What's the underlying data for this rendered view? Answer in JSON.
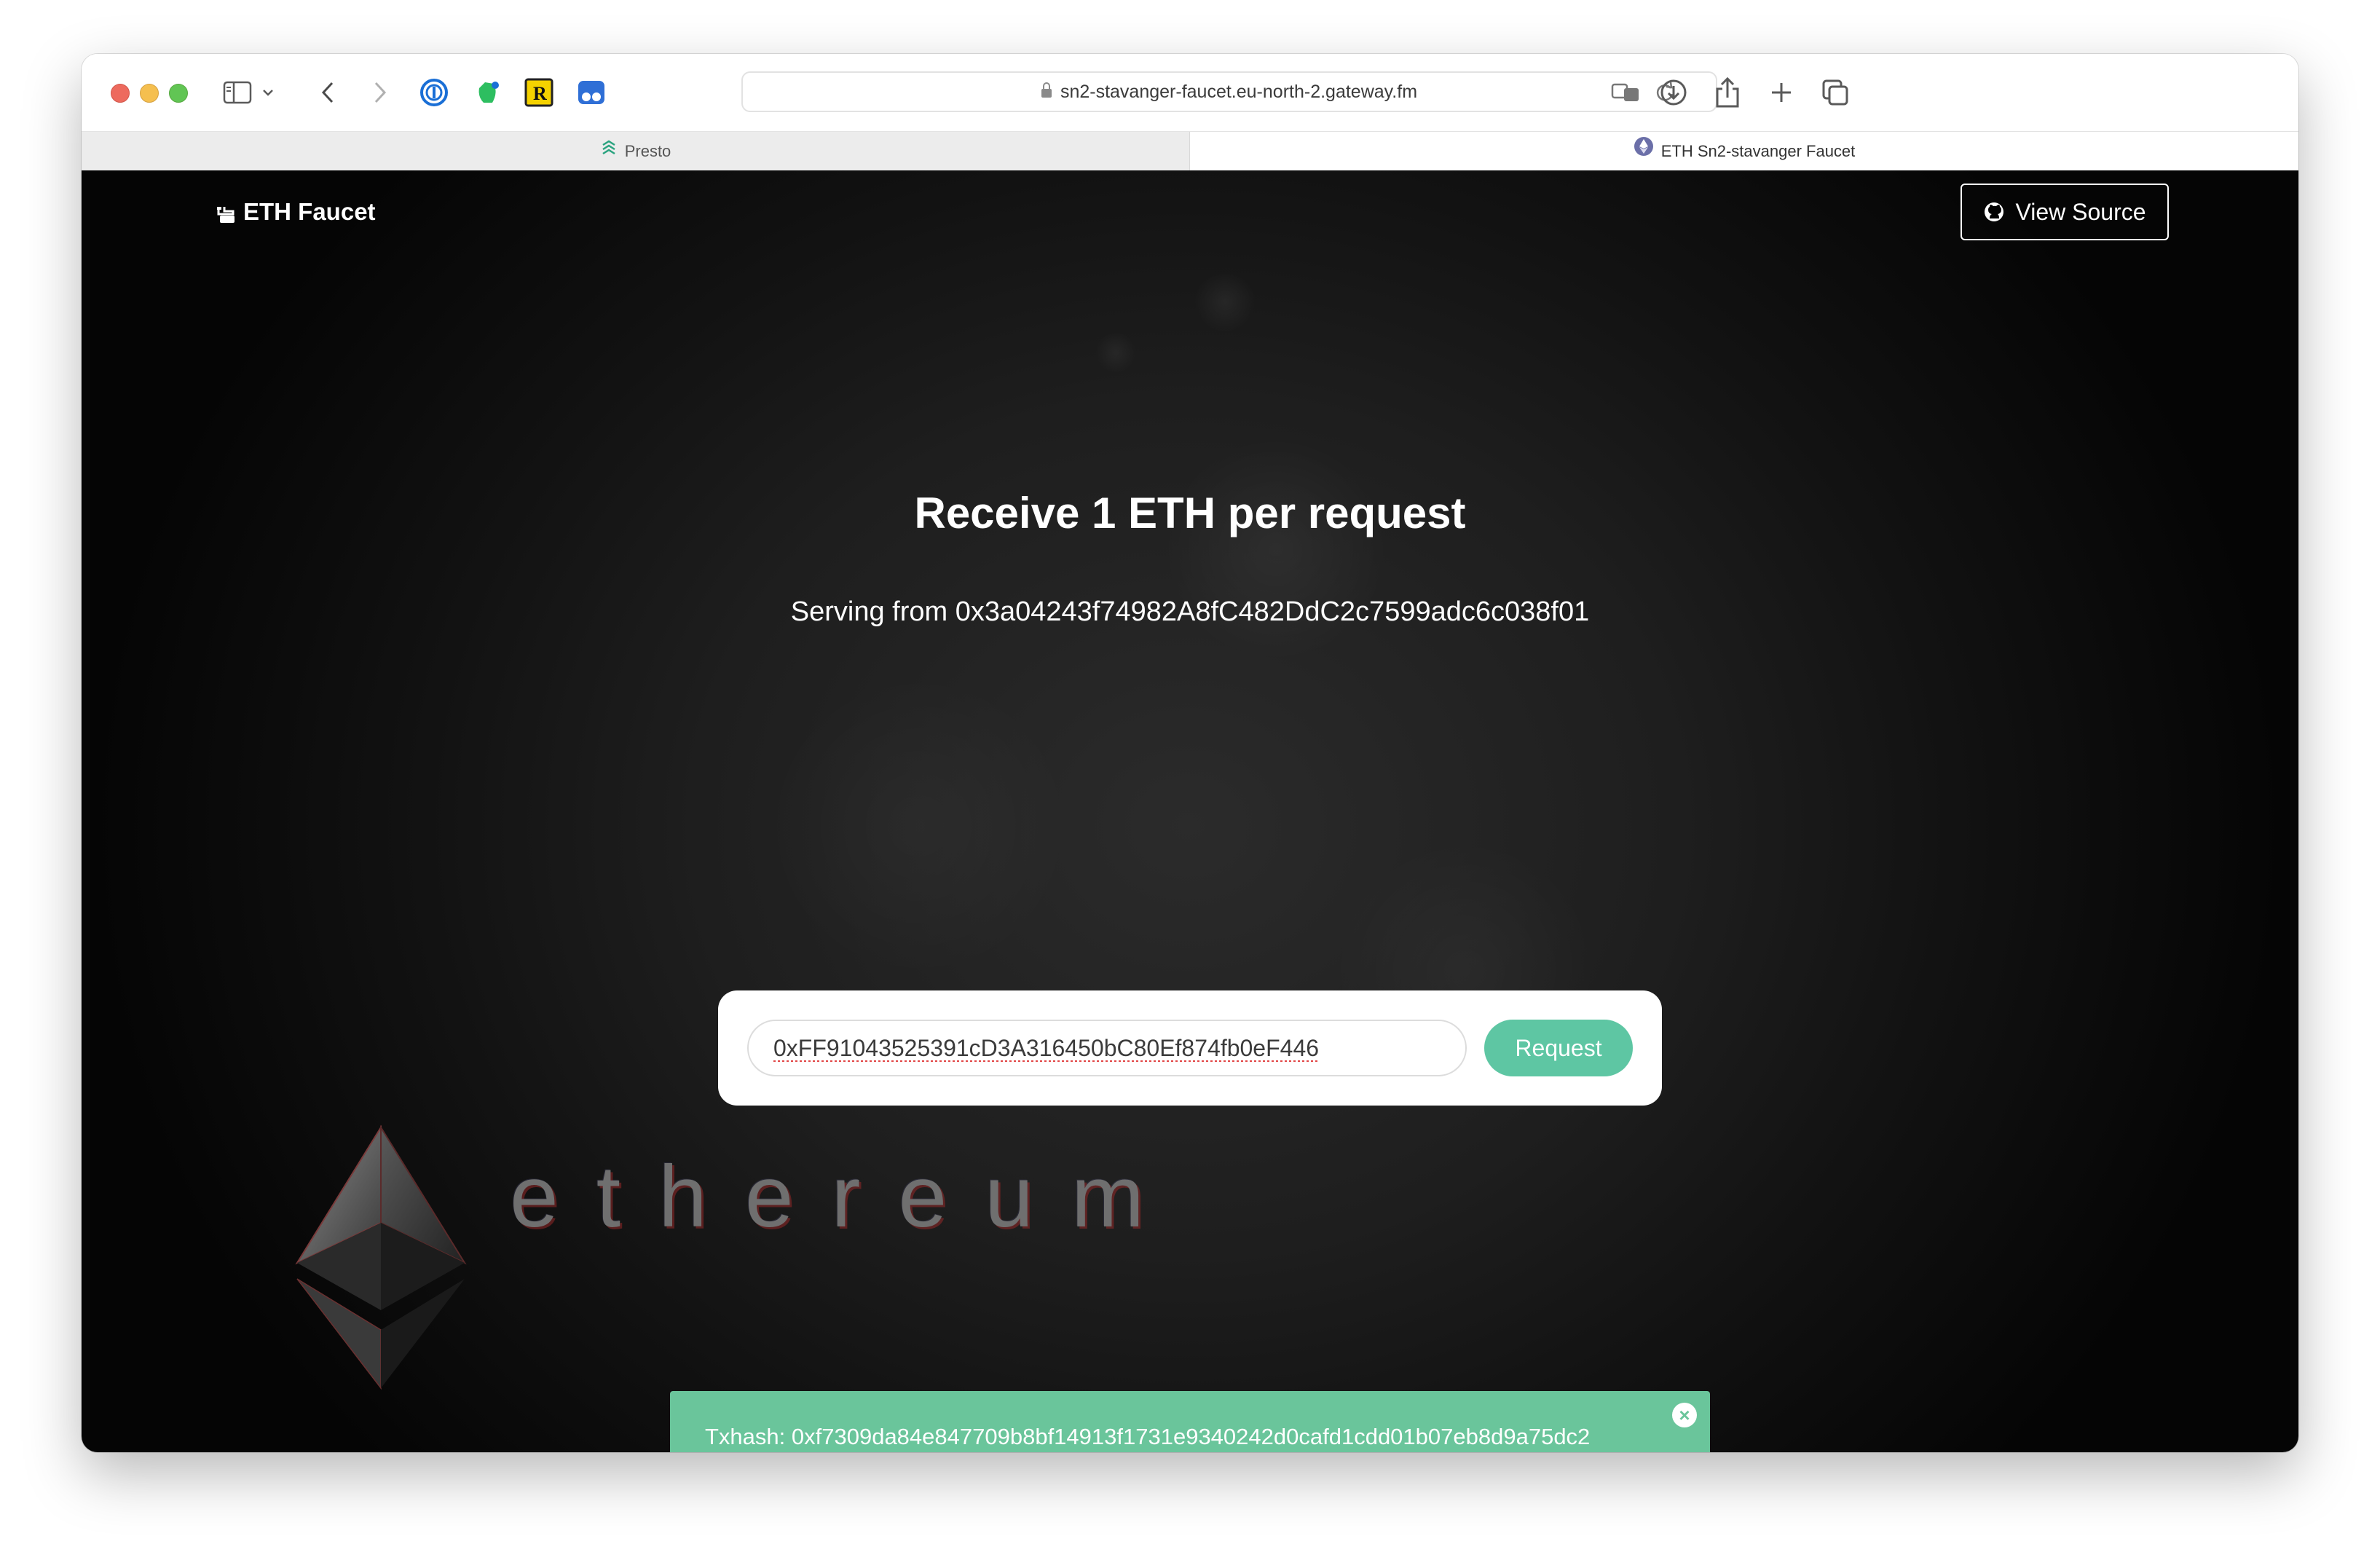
{
  "browser": {
    "url": "sn2-stavanger-faucet.eu-north-2.gateway.fm",
    "tabs": [
      {
        "label": "Presto",
        "active": false
      },
      {
        "label": "ETH Sn2-stavanger Faucet",
        "active": true
      }
    ]
  },
  "page": {
    "brand": "ETH Faucet",
    "view_source_label": "View Source",
    "headline": "Receive 1 ETH per request",
    "serving": "Serving from 0x3a04243f74982A8fC482DdC2c7599adc6c038f01",
    "address_value": "0xFF91043525391cD3A316450bC80Ef874fb0eF446",
    "request_label": "Request",
    "ethereum_wordmark": "ethereum"
  },
  "toast": {
    "message": "Txhash: 0xf7309da84e847709b8bf14913f1731e9340242d0cafd1cdd01b07eb8d9a75dc2",
    "close_icon": "×"
  },
  "colors": {
    "accent": "#5ec6a3",
    "toast_bg": "#6ac59b",
    "page_bg": "#1a1a1a"
  }
}
